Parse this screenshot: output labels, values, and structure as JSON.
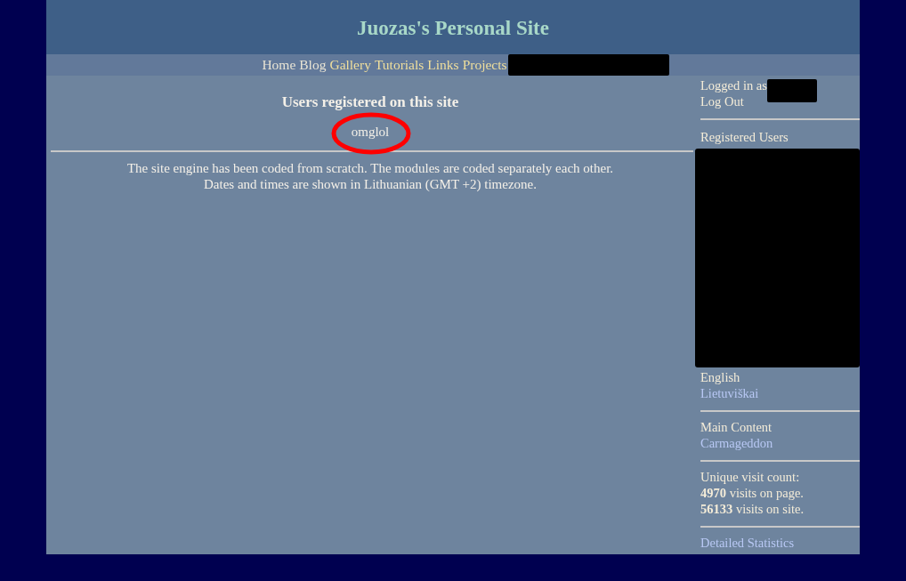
{
  "site_title": "Juozas's Personal Site",
  "nav": [
    {
      "label": "Home",
      "visited": true
    },
    {
      "label": "Blog",
      "visited": true
    },
    {
      "label": "Gallery",
      "visited": false
    },
    {
      "label": "Tutorials",
      "visited": false
    },
    {
      "label": "Links",
      "visited": false
    },
    {
      "label": "Projects",
      "visited": false
    }
  ],
  "main": {
    "heading": "Users registered on this site",
    "users": [
      "omglol"
    ],
    "footer_lines": [
      "The site engine has been coded from scratch. The modules are coded separately each other.",
      "Dates and times are shown in Lithuanian (GMT +2) timezone."
    ]
  },
  "sidebar": {
    "sections": [
      {
        "kind": "login",
        "label": "Logged in as",
        "link": "Log Out"
      },
      {
        "kind": "users",
        "label": "Registered Users"
      },
      {
        "kind": "list",
        "items": [
          {
            "label": "English",
            "link": false
          },
          {
            "label": "Lietuviškai",
            "link": true
          }
        ]
      },
      {
        "kind": "list",
        "items": [
          {
            "label": "Main Content",
            "link": false
          },
          {
            "label": "Carmageddon",
            "link": true
          }
        ]
      },
      {
        "kind": "stats",
        "lines": [
          "Unique visit count:",
          "**4970** visits on page.",
          "**56133** visits on site."
        ]
      },
      {
        "kind": "list",
        "items": [
          {
            "label": "Detailed Statistics",
            "link": true
          }
        ]
      }
    ]
  }
}
